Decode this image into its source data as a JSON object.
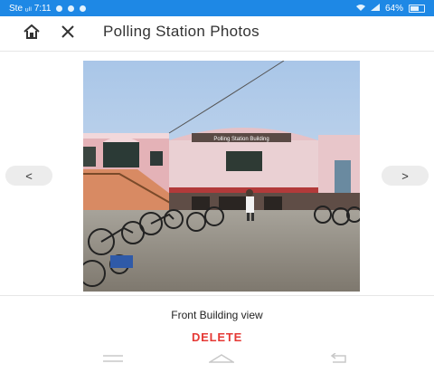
{
  "status_bar": {
    "left_text": "Ste ᵤₗₗ 7:11",
    "right_text": "64%"
  },
  "app_bar": {
    "title": "Polling Station Photos",
    "home_icon": "home-icon",
    "close_icon": "close-icon"
  },
  "photo": {
    "sign_text": "Polling Station Building"
  },
  "navigation": {
    "prev_label": "<",
    "next_label": ">"
  },
  "caption": "Front Building view",
  "delete_label": "DELETE",
  "system_nav": {
    "menu_icon": "menu-icon",
    "home_icon": "home-key-icon",
    "back_icon": "back-icon"
  },
  "colors": {
    "status_bar": "#1e88e5",
    "delete": "#e53935",
    "building": "#e7b7bd"
  }
}
